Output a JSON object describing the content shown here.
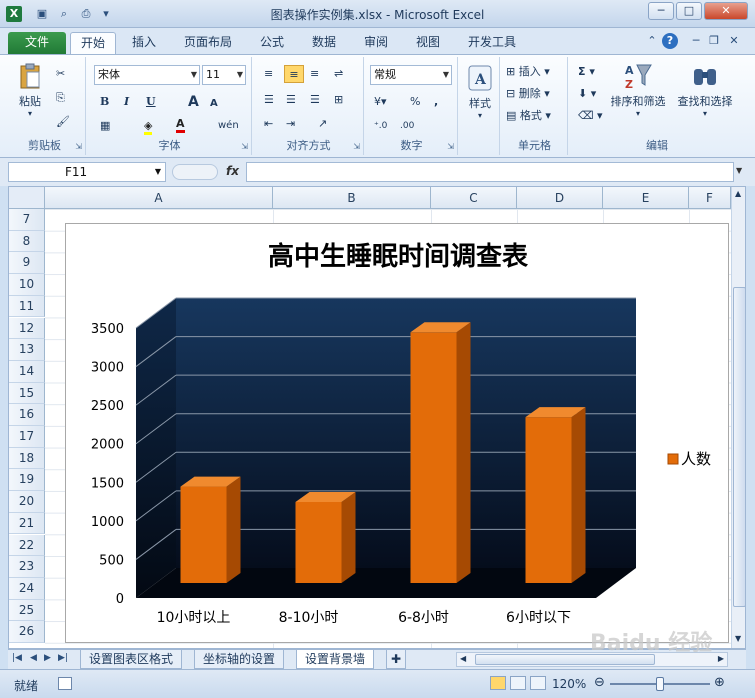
{
  "window": {
    "title": "图表操作实例集.xlsx - Microsoft Excel",
    "app_icon": "X",
    "controls": [
      "─",
      "□",
      "✕"
    ]
  },
  "ribbon_tabs": [
    "文件",
    "开始",
    "插入",
    "页面布局",
    "公式",
    "数据",
    "审阅",
    "视图",
    "开发工具"
  ],
  "ribbon": {
    "clipboard": {
      "paste": "粘贴",
      "label": "剪贴板"
    },
    "font": {
      "name": "宋体",
      "size": "11",
      "bold": "B",
      "italic": "I",
      "underline": "U",
      "grow": "A",
      "shrink": "A",
      "label": "字体",
      "wen": "wén"
    },
    "alignment": {
      "label": "对齐方式"
    },
    "number": {
      "format": "常规",
      "percent": "%",
      "comma": ",",
      "label": "数字"
    },
    "styles": {
      "label": "样式"
    },
    "cells": {
      "insert": "插入",
      "delete": "删除",
      "format": "格式",
      "label": "单元格"
    },
    "editing": {
      "sum": "Σ",
      "sort_filter": "排序和筛选",
      "find_select": "查找和选择",
      "label": "编辑"
    }
  },
  "formula_bar": {
    "name_box": "F11",
    "fx": "fx",
    "value": ""
  },
  "grid": {
    "columns": [
      "A",
      "B",
      "C",
      "D",
      "E",
      "F"
    ],
    "rows": [
      "7",
      "8",
      "9",
      "10",
      "11",
      "12",
      "13",
      "14",
      "15",
      "16",
      "17",
      "18",
      "19",
      "20",
      "21",
      "22",
      "23",
      "24",
      "25",
      "26"
    ]
  },
  "chart_data": {
    "type": "bar",
    "title": "高中生睡眠时间调查表",
    "categories": [
      "10小时以上",
      "8-10小时",
      "6-8小时",
      "6小时以下"
    ],
    "series": [
      {
        "name": "人数",
        "values": [
          1250,
          1050,
          3250,
          2150
        ],
        "color": "#e36c09"
      }
    ],
    "ylim": [
      0,
      3500
    ],
    "yticks": [
      "0",
      "500",
      "1000",
      "1500",
      "2000",
      "2500",
      "3000",
      "3500"
    ],
    "legend_position": "right",
    "grid": true,
    "back_wall_color": "#17375e",
    "style": "3d-column"
  },
  "sheet_tabs": [
    "设置图表区格式",
    "坐标轴的设置",
    "设置背景墙"
  ],
  "status": {
    "ready": "就绪",
    "zoom": "120%"
  },
  "watermark": "Baidu 经验"
}
